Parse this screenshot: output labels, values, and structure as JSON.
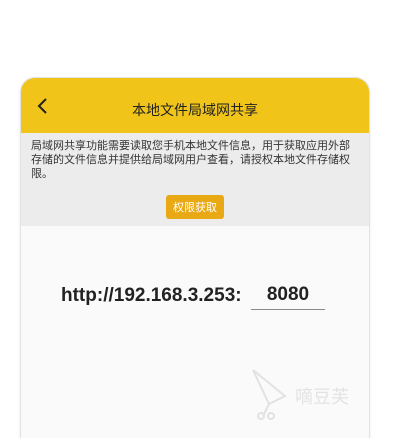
{
  "header": {
    "title": "本地文件局域网共享"
  },
  "notice": {
    "text": "局域网共享功能需要读取您手机本地文件信息，用于获取应用外部存储的文件信息并提供给局域网用户查看，请授权本地文件存储权限。"
  },
  "permission_button": {
    "label": "权限获取"
  },
  "server": {
    "url": "http://192.168.3.253:",
    "port": "8080"
  },
  "watermark": {
    "text": "嘀豆芙",
    "icon": "kite-logo-icon"
  },
  "colors": {
    "header_bg": "#f0c419",
    "button_bg": "#e9a915"
  }
}
